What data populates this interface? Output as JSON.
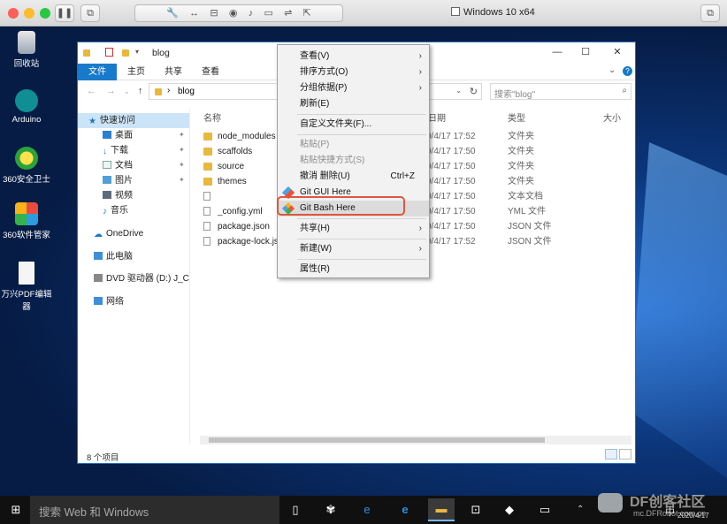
{
  "mac": {
    "title": "Windows 10 x64",
    "toolbar_icons": [
      "pause-icon",
      "settings-icon",
      "resize-icon",
      "drive-icon",
      "camera-icon",
      "audio-icon",
      "video-icon",
      "usb-icon",
      "share-icon"
    ]
  },
  "desktop": {
    "icons": [
      {
        "label": "回收站"
      },
      {
        "label": "Arduino"
      },
      {
        "label": "360安全卫士"
      },
      {
        "label": "360软件管家"
      },
      {
        "label": "万兴PDF编辑器"
      }
    ]
  },
  "explorer": {
    "title": "blog",
    "ribbon_tabs": [
      "文件",
      "主页",
      "共享",
      "查看"
    ],
    "address": "blog",
    "search_placeholder": "搜索\"blog\"",
    "sidebar": [
      {
        "label": "快速访问"
      },
      {
        "label": "桌面"
      },
      {
        "label": "下载"
      },
      {
        "label": "文档"
      },
      {
        "label": "图片"
      },
      {
        "label": "视频"
      },
      {
        "label": "音乐"
      },
      {
        "label": "OneDrive"
      },
      {
        "label": "此电脑"
      },
      {
        "label": "DVD 驱动器 (D:) J_CC"
      },
      {
        "label": "网络"
      }
    ],
    "columns": {
      "name": "名称",
      "date": "日期",
      "type": "类型",
      "size": "大小"
    },
    "files": [
      {
        "name": "node_modules",
        "date": "0/4/17 17:52",
        "type": "文件夹",
        "kind": "folder"
      },
      {
        "name": "scaffolds",
        "date": "0/4/17 17:50",
        "type": "文件夹",
        "kind": "folder"
      },
      {
        "name": "source",
        "date": "0/4/17 17:50",
        "type": "文件夹",
        "kind": "folder"
      },
      {
        "name": "themes",
        "date": "0/4/17 17:50",
        "type": "文件夹",
        "kind": "folder"
      },
      {
        "name": "",
        "date": "0/4/17 17:50",
        "type": "文本文档",
        "kind": "file"
      },
      {
        "name": "_config.yml",
        "date": "0/4/17 17:50",
        "type": "YML 文件",
        "kind": "file"
      },
      {
        "name": "package.json",
        "date": "0/4/17 17:50",
        "type": "JSON 文件",
        "kind": "file"
      },
      {
        "name": "package-lock.js",
        "date": "0/4/17 17:52",
        "type": "JSON 文件",
        "kind": "file"
      }
    ],
    "status": "8 个项目"
  },
  "context_menu": {
    "items": [
      {
        "label": "查看(V)",
        "submenu": true
      },
      {
        "label": "排序方式(O)",
        "submenu": true
      },
      {
        "label": "分组依据(P)",
        "submenu": true
      },
      {
        "label": "刷新(E)"
      },
      {
        "label": "自定义文件夹(F)..."
      },
      {
        "label": "粘贴(P)",
        "disabled": true
      },
      {
        "label": "粘贴快捷方式(S)",
        "disabled": true
      },
      {
        "label": "撤消 删除(U)",
        "shortcut": "Ctrl+Z"
      },
      {
        "label": "Git GUI Here"
      },
      {
        "label": "Git Bash Here",
        "highlighted": true
      },
      {
        "label": "共享(H)",
        "submenu": true
      },
      {
        "label": "新建(W)",
        "submenu": true
      },
      {
        "label": "属性(R)"
      }
    ]
  },
  "taskbar": {
    "search_placeholder": "搜索 Web 和 Windows",
    "clock_date": "2020/4/17",
    "lang": "中"
  },
  "watermark": {
    "brand": "DF创客社区",
    "url": "mc.DFRobot.com.cn"
  },
  "colors": {
    "accent": "#1979ca",
    "highlight_border": "#e0553f",
    "folder": "#e9b83d"
  }
}
